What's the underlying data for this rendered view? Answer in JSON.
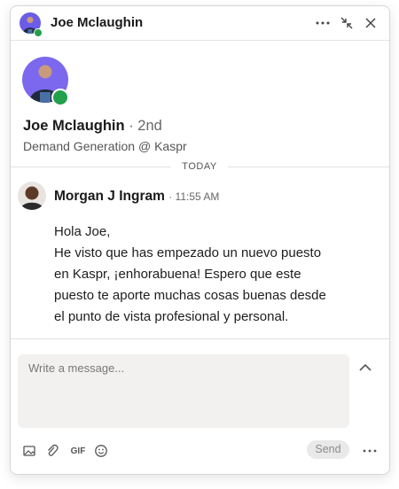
{
  "header": {
    "title": "Joe Mclaughin",
    "icons": [
      "more-icon",
      "minimize-icon",
      "close-icon"
    ]
  },
  "profile": {
    "name": "Joe Mclaughin",
    "degree": "· 2nd",
    "headline": "Demand Generation @ Kaspr",
    "status_color": "#22a04b"
  },
  "thread": {
    "date_label": "TODAY",
    "message": {
      "sender": "Morgan J Ingram",
      "time": "· 11:55 AM",
      "lines": [
        "Hola Joe,",
        "He visto que has empezado un nuevo puesto",
        "en Kaspr, ¡enhorabuena! Espero que este",
        "puesto te aporte muchas cosas buenas desde",
        "el punto de vista profesional y personal."
      ]
    }
  },
  "compose": {
    "placeholder": "Write a message...",
    "value": "",
    "send_label": "Send",
    "gif_label": "GIF"
  },
  "colors": {
    "online": "#22a04b",
    "avatar_bg": "#7b68ee"
  }
}
